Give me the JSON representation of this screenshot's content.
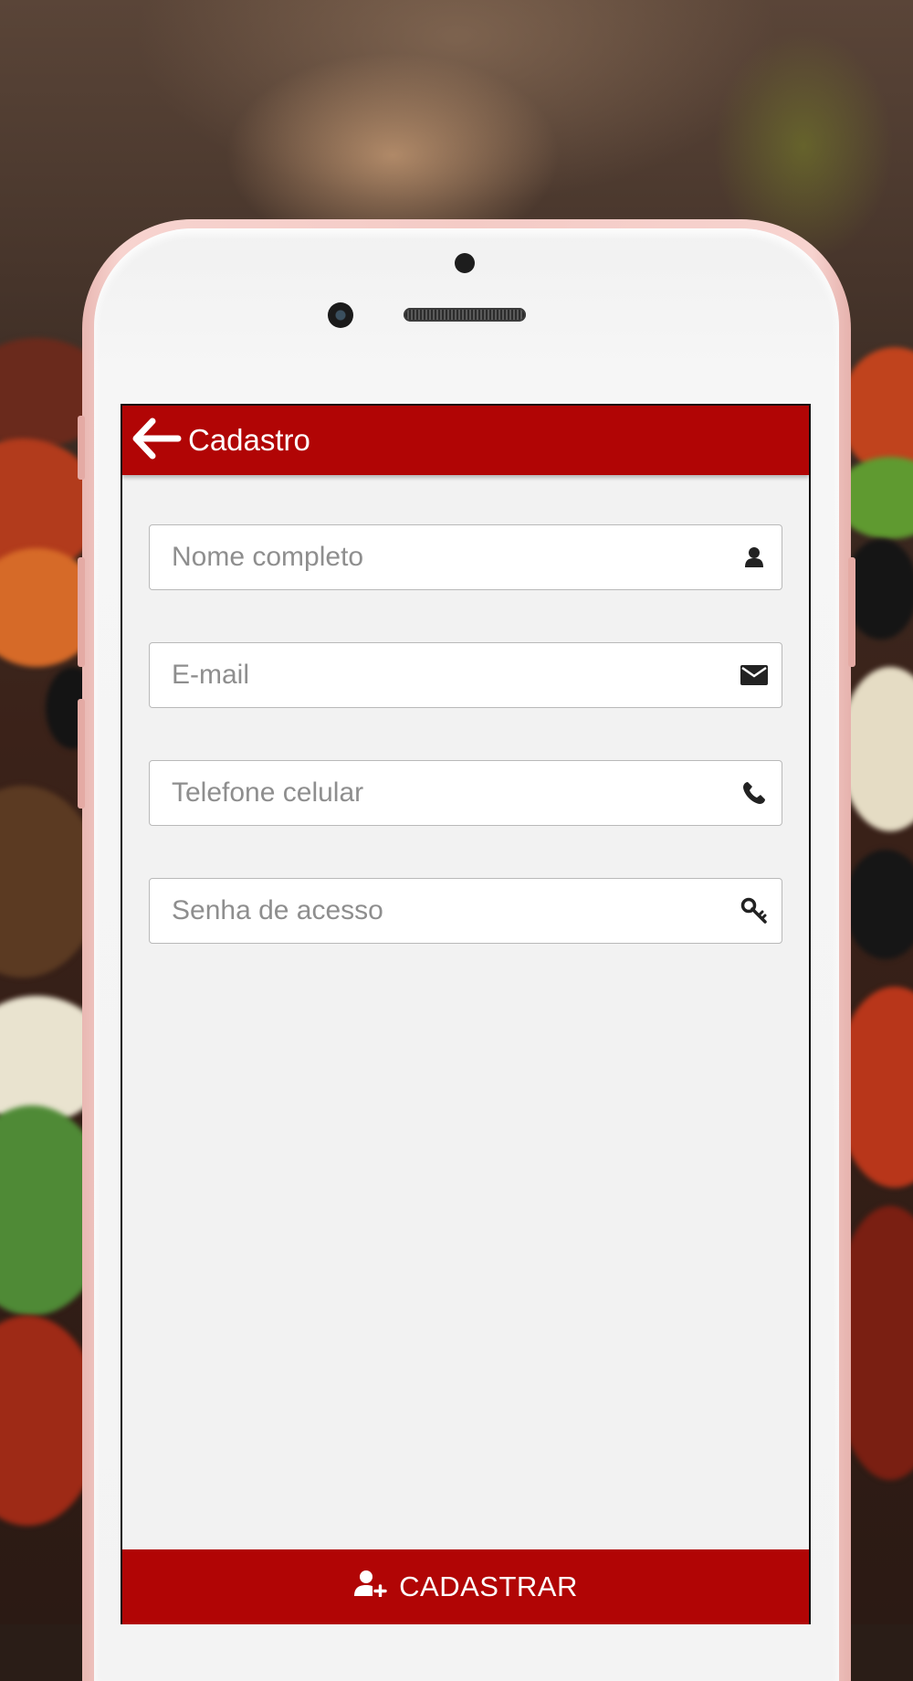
{
  "header": {
    "title": "Cadastro",
    "back_icon": "arrow-left-icon"
  },
  "form": {
    "fields": [
      {
        "name": "full-name",
        "placeholder": "Nome completo",
        "icon": "user-icon"
      },
      {
        "name": "email",
        "placeholder": "E-mail",
        "icon": "envelope-icon"
      },
      {
        "name": "phone",
        "placeholder": "Telefone celular",
        "icon": "phone-icon"
      },
      {
        "name": "password",
        "placeholder": "Senha de acesso",
        "icon": "key-icon"
      }
    ]
  },
  "footer": {
    "submit_label": "CADASTRAR",
    "submit_icon": "user-plus-icon"
  },
  "colors": {
    "accent": "#b10505",
    "screen_bg": "#f2f2f2",
    "phone_frame": "#f4cbc6"
  }
}
